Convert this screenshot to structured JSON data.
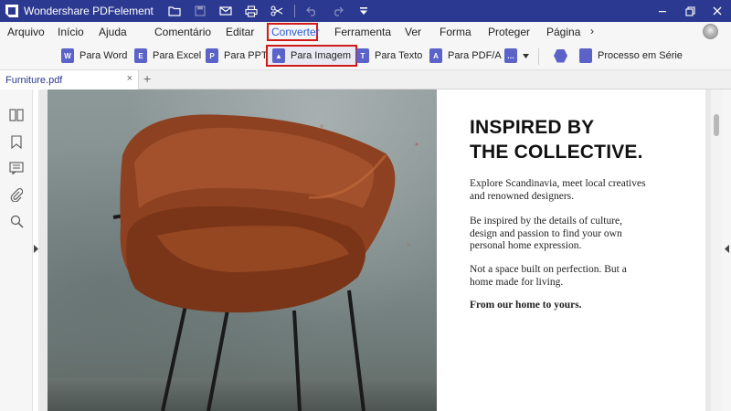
{
  "app": {
    "title": "Wondershare PDFelement"
  },
  "quick_access": [
    {
      "icon": "folder-icon"
    },
    {
      "icon": "save-icon"
    },
    {
      "icon": "mail-icon"
    },
    {
      "icon": "print-icon"
    },
    {
      "icon": "scissors-icon"
    },
    {
      "icon": "undo-icon"
    },
    {
      "icon": "redo-icon"
    },
    {
      "icon": "customize-toolbar-icon"
    }
  ],
  "menu": {
    "items": [
      "Arquivo",
      "Início",
      "Ajuda",
      "Comentário",
      "Editar",
      "Converter",
      "Ferramenta",
      "Ver",
      "Forma",
      "Proteger",
      "Página"
    ],
    "active": "Converter",
    "more": "›"
  },
  "ribbon": {
    "buttons": [
      {
        "label": "Para Word",
        "icon": "word-icon",
        "glyph": "W"
      },
      {
        "label": "Para Excel",
        "icon": "excel-icon",
        "glyph": "E"
      },
      {
        "label": "Para PPT",
        "icon": "ppt-icon",
        "glyph": "P"
      },
      {
        "label": "Para Imagem",
        "icon": "image-icon",
        "glyph": "▲",
        "selected": true
      },
      {
        "label": "Para Texto",
        "icon": "text-icon",
        "glyph": "T"
      },
      {
        "label": "Para PDF/A",
        "icon": "pdfa-icon",
        "glyph": "A"
      },
      {
        "label": "",
        "icon": "more-formats-icon",
        "glyph": "…"
      },
      {
        "label": "",
        "icon": "settings-hex-icon",
        "glyph": ""
      },
      {
        "label": "Processo em Série",
        "icon": "batch-icon",
        "glyph": ""
      }
    ]
  },
  "tabs": {
    "open": [
      {
        "name": "Furniture.pdf",
        "close": "×"
      }
    ],
    "new_tab": "+"
  },
  "left_panel": {
    "icons": [
      "thumbnails-icon",
      "bookmark-icon",
      "comment-icon",
      "attachment-icon",
      "search-icon"
    ]
  },
  "document": {
    "headline_line1": "INSPIRED BY",
    "headline_line2": "THE COLLECTIVE.",
    "paragraphs": [
      [
        "Explore Scandinavia, meet local creatives",
        "and renowned designers."
      ],
      [
        "Be inspired by the details of culture,",
        "design and passion to find your own",
        "personal home expression."
      ],
      [
        "Not a space built on perfection. But a",
        "home made for living."
      ]
    ],
    "closing": "From our home to yours."
  },
  "colors": {
    "titlebar": "#2b3990",
    "active_menu": "#2b5bd7",
    "highlight_box": "#d11a1a",
    "ribbon_icon": "#5b63c9",
    "chair_leather": "#9a4a24",
    "chair_frame": "#1a1a1a"
  }
}
